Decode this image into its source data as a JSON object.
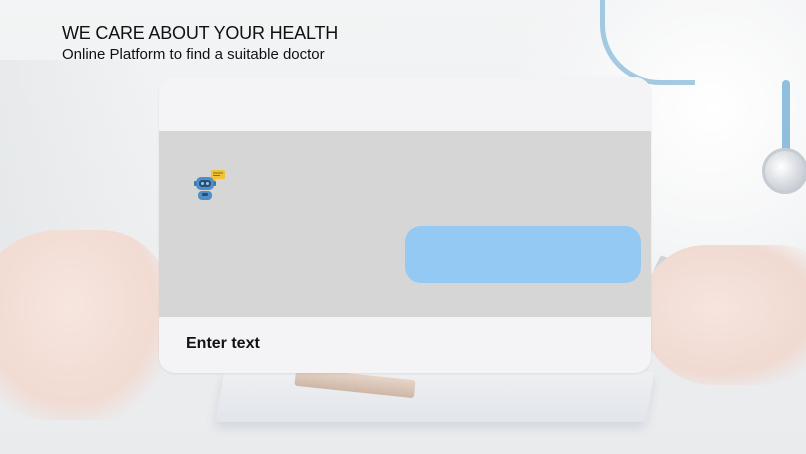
{
  "header": {
    "title": "WE CARE ABOUT YOUR HEALTH",
    "subtitle": "Online Platform to find a suitable doctor"
  },
  "chat": {
    "bot_avatar_icon": "robot-assistant-icon",
    "user_message": "",
    "input": {
      "placeholder": "Enter text"
    }
  },
  "colors": {
    "chat_body": "#d6d6d6",
    "user_bubble": "#93c9f3",
    "card": "#f4f4f6"
  }
}
